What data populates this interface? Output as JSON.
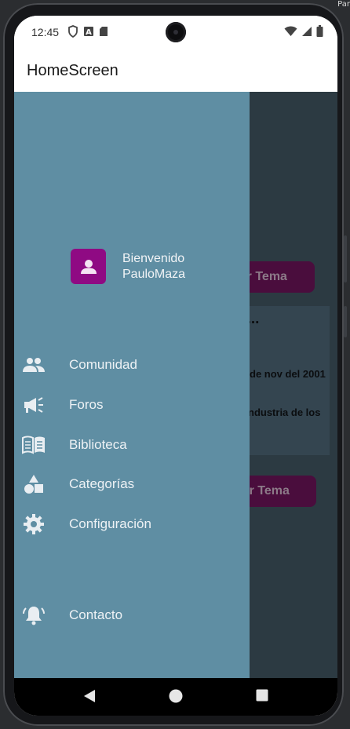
{
  "host": {
    "corner_text": "Par"
  },
  "status_bar": {
    "time": "12:45",
    "left_icons": [
      "shield-icon",
      "a-icon",
      "sd-card-icon"
    ],
    "right_icons": [
      "wifi-icon",
      "signal-icon",
      "battery-icon"
    ]
  },
  "app_bar": {
    "title": "HomeScreen"
  },
  "background_content": {
    "button_1": "gar Tema",
    "heading": "a...",
    "date_text": "de nov del 2001",
    "desc_text": "ndustria de los",
    "button_2": "egar Tema"
  },
  "drawer": {
    "profile": {
      "greeting": "Bienvenido",
      "username": "PauloMaza",
      "avatar_icon": "person-icon"
    },
    "items": [
      {
        "label": "Comunidad",
        "icon": "people-icon"
      },
      {
        "label": "Foros",
        "icon": "megaphone-icon"
      },
      {
        "label": "Biblioteca",
        "icon": "book-icon"
      },
      {
        "label": "Categorías",
        "icon": "shapes-icon"
      },
      {
        "label": "Configuración",
        "icon": "gear-icon"
      },
      {
        "label": "Contacto",
        "icon": "bell-icon"
      }
    ]
  },
  "nav_bar": {
    "buttons": [
      "back-icon",
      "home-icon",
      "recents-icon"
    ]
  },
  "colors": {
    "drawer_bg": "#5f8ea3",
    "avatar_bg": "#8f0a83",
    "scrim": "#2c3a42",
    "button_dim": "#4a0d3d"
  }
}
